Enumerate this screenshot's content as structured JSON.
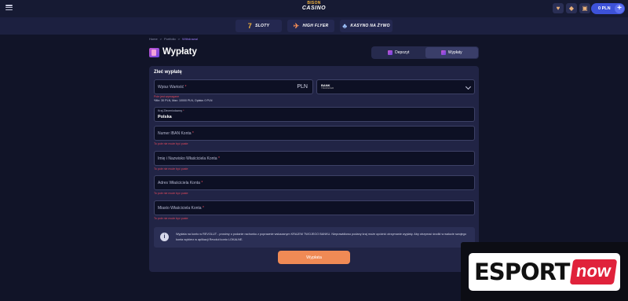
{
  "header": {
    "logo_line1": "BISON",
    "logo_line2": "CASINO",
    "balance": "0 PLN",
    "plus": "+"
  },
  "nav": [
    {
      "label": "SLOTY",
      "icon": "slot-seven-icon",
      "glyph": "7"
    },
    {
      "label": "HIGH FLYER",
      "icon": "plane-icon",
      "glyph": "✈"
    },
    {
      "label": "KASYNO NA ŻYWO",
      "icon": "cards-icon",
      "glyph": "♣"
    }
  ],
  "breadcrumb": [
    "Home",
    ">",
    "Portfolio",
    ">",
    "Withdrawal"
  ],
  "page": {
    "title": "Wypłaty",
    "tabs": [
      {
        "label": "Depozyt",
        "active": false
      },
      {
        "label": "Wypłaty",
        "active": true
      }
    ]
  },
  "form": {
    "heading": "Zleć wypłatę",
    "amount_placeholder": "Wpisz Wartość",
    "required": "*",
    "currency": "PLN",
    "bank_name": "BANK",
    "bank_sub": "TRANSFER",
    "amount_error": "Pole jest wymagane",
    "limits": "*Min: 30 PLN, Max: 10000 PLN, Opłata: 0 PLN",
    "country_label": "Kraj Zleceniodawcy",
    "country_value": "Polska",
    "iban_placeholder": "Numer IBAN Konta",
    "owner_placeholder": "Imię i Nazwisko Właściciela Konta",
    "address_placeholder": "Adres Właściciela Konta",
    "city_placeholder": "Miasto Właściciela Konta",
    "field_error": "To pole nie może być puste",
    "info_text": "Wypłata na konto w REVOLUT - prosimy o podanie rachunku z poprawnie wskazanym KRAJEM TWOJEGO BANKU. Nieprawidłowo podany kraj może opóźnić otrzymanie wypłaty. Aby otrzymać środki w walucie swojego konta wybierz w aplikacji Revolut konto LOKALNE.",
    "submit": "Wypłata"
  },
  "watermark": {
    "part1": "ESPORT",
    "part2": "now"
  }
}
